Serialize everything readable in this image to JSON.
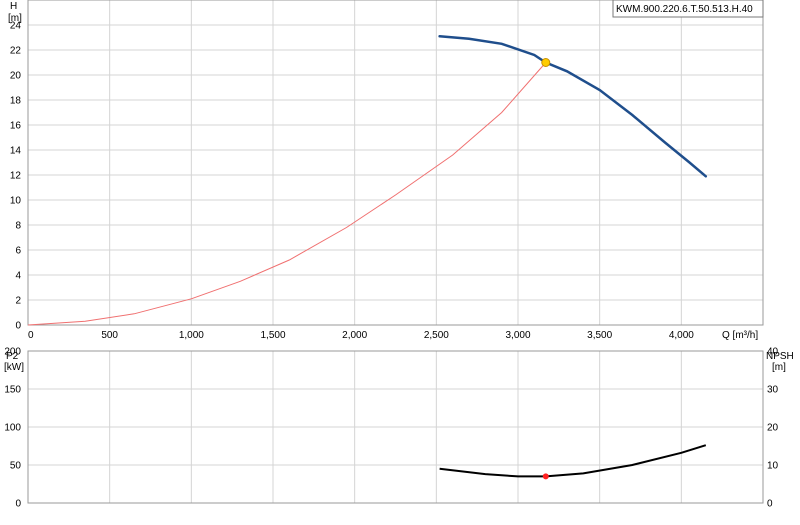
{
  "model_label": "KWM.900.220.6.T.50.513.H.40",
  "colors": {
    "pump_curve": "#1f4e8c",
    "system_curve": "#f07070",
    "duty_point": "#ffcc00",
    "power_curve": "#000000",
    "power_point": "#ff2020",
    "grid": "#d4d4d4"
  },
  "chart_data": [
    {
      "type": "line",
      "ylabel_line1": "H",
      "ylabel_line2": "[m]",
      "xlabel": "Q [m³/h]",
      "xlim": [
        0,
        4500
      ],
      "ylim": [
        0,
        26
      ],
      "x_ticks": [
        0,
        500,
        1000,
        1500,
        2000,
        2500,
        3000,
        3500,
        4000
      ],
      "x_tick_labels": [
        "0",
        "500",
        "1,000",
        "1,500",
        "2,000",
        "2,500",
        "3,000",
        "3,500",
        "4,000"
      ],
      "y_ticks": [
        0,
        2,
        4,
        6,
        8,
        10,
        12,
        14,
        16,
        18,
        20,
        22,
        24
      ],
      "grid": true,
      "series": [
        {
          "key": "pump",
          "x": [
            2520,
            2700,
            2900,
            3100,
            3170,
            3300,
            3500,
            3700,
            3900,
            4050,
            4150
          ],
          "y": [
            23.1,
            22.9,
            22.5,
            21.6,
            21.0,
            20.3,
            18.8,
            16.8,
            14.6,
            13.0,
            11.9
          ]
        },
        {
          "key": "system",
          "x": [
            0,
            350,
            650,
            1000,
            1300,
            1600,
            1950,
            2250,
            2600,
            2900,
            3170
          ],
          "y": [
            0,
            0.3,
            0.9,
            2.1,
            3.5,
            5.2,
            7.8,
            10.4,
            13.6,
            17.0,
            21.0
          ]
        }
      ],
      "duty_point": {
        "x": 3170,
        "y": 21.0
      }
    },
    {
      "type": "line",
      "ylabel_line1": "P2",
      "ylabel_line2": "[kW]",
      "y2label_line1": "NPSH",
      "y2label_line2": "[m]",
      "xlim": [
        0,
        4500
      ],
      "ylim": [
        0,
        200
      ],
      "y2lim": [
        0,
        40
      ],
      "y_ticks": [
        0,
        50,
        100,
        150,
        200
      ],
      "y2_ticks": [
        10,
        20,
        30,
        40
      ],
      "grid": true,
      "series": [
        {
          "key": "power",
          "x": [
            2520,
            2800,
            3000,
            3170,
            3400,
            3700,
            4000,
            4150
          ],
          "y": [
            45,
            38,
            35,
            35,
            39,
            50,
            66,
            76
          ]
        }
      ],
      "duty_point": {
        "x": 3170,
        "y": 35
      }
    }
  ]
}
